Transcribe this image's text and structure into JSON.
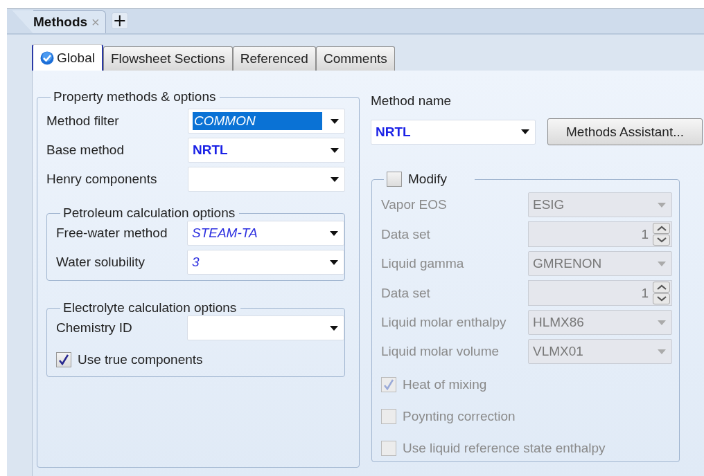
{
  "document_tabs": {
    "tabs": [
      {
        "label": "Methods",
        "close": "×",
        "selected": true
      }
    ],
    "new_tab": "+"
  },
  "form_tabs": [
    {
      "label": "Global",
      "selected": true,
      "complete": true
    },
    {
      "label": "Flowsheet Sections",
      "selected": false,
      "complete": false
    },
    {
      "label": "Referenced",
      "selected": false,
      "complete": false
    },
    {
      "label": "Comments",
      "selected": false,
      "complete": false
    }
  ],
  "property_methods": {
    "title": "Property methods & options",
    "fields": [
      {
        "label": "Method filter",
        "value": "COMMON",
        "kind": "highlighted"
      },
      {
        "label": "Base method",
        "value": "NRTL",
        "kind": "user"
      },
      {
        "label": "Henry components"
      }
    ],
    "petroleum": {
      "title": "Petroleum calculation options",
      "fields": [
        {
          "label": "Free-water method",
          "value": "STEAM-TA",
          "kind": "default"
        },
        {
          "label": "Water solubility",
          "value": "3",
          "kind": "default"
        }
      ]
    },
    "electrolyte": {
      "title": "Electrolyte calculation options",
      "fields": [
        {
          "label": "Chemistry ID"
        }
      ],
      "options": [
        {
          "label": "Use true components",
          "checked": true
        }
      ]
    }
  },
  "method_name": {
    "label": "Method name",
    "value": "NRTL",
    "kind": "user"
  },
  "methods_assistant_button": "Methods Assistant...",
  "modify": {
    "label": "Modify",
    "checked": false,
    "disabled": true,
    "fields": [
      {
        "kind": "dropdown",
        "label": "Vapor EOS",
        "value": "ESIG"
      },
      {
        "kind": "spinner",
        "label": "Data set",
        "value": "1"
      },
      {
        "kind": "dropdown",
        "label": "Liquid gamma",
        "value": "GMRENON"
      },
      {
        "kind": "spinner",
        "label": "Data set",
        "value": "1"
      },
      {
        "kind": "dropdown",
        "label": "Liquid molar enthalpy",
        "value": "HLMX86"
      },
      {
        "kind": "dropdown",
        "label": "Liquid molar volume",
        "value": "VLMX01"
      }
    ],
    "options": [
      {
        "label": "Heat of mixing",
        "checked": true
      },
      {
        "label": "Poynting correction",
        "checked": false
      },
      {
        "label": "Use liquid reference state enthalpy",
        "checked": false
      }
    ]
  }
}
